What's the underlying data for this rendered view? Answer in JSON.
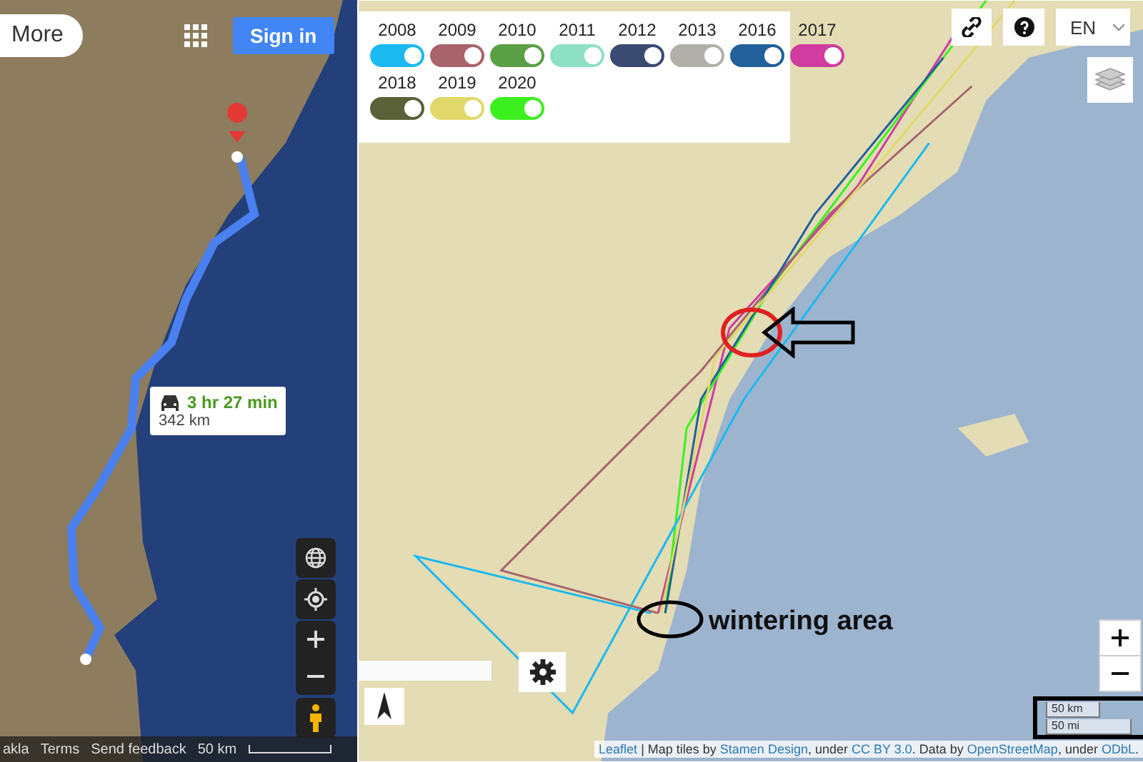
{
  "left_map": {
    "more_button": "More",
    "sign_in_button": "Sign in",
    "route_info": {
      "duration": "3 hr 27 min",
      "distance": "342 km"
    },
    "footer": {
      "attribution": "akla",
      "terms": "Terms",
      "feedback": "Send feedback",
      "scale": "50 km"
    }
  },
  "right_map": {
    "years": [
      {
        "label": "2008",
        "color": "#1ab9f0",
        "on": true
      },
      {
        "label": "2009",
        "color": "#a8636b",
        "on": true
      },
      {
        "label": "2010",
        "color": "#5a9e46",
        "on": true
      },
      {
        "label": "2011",
        "color": "#8ee0c4",
        "on": true
      },
      {
        "label": "2012",
        "color": "#3a4a70",
        "on": true
      },
      {
        "label": "2013",
        "color": "#b0b0a8",
        "on": true
      },
      {
        "label": "2016",
        "color": "#22609a",
        "on": true
      },
      {
        "label": "2017",
        "color": "#d03ca0",
        "on": true
      },
      {
        "label": "2018",
        "color": "#5a6038",
        "on": true
      },
      {
        "label": "2019",
        "color": "#e0d86a",
        "on": true
      },
      {
        "label": "2020",
        "color": "#3cf020",
        "on": true
      }
    ],
    "language": "EN",
    "annotation": "wintering area",
    "scale": [
      "50 km",
      "50 mi"
    ],
    "attribution": [
      {
        "kind": "link",
        "text": "Leaflet"
      },
      {
        "kind": "text",
        "text": " | Map tiles by "
      },
      {
        "kind": "link",
        "text": "Stamen Design"
      },
      {
        "kind": "text",
        "text": ", under "
      },
      {
        "kind": "link",
        "text": "CC BY 3.0"
      },
      {
        "kind": "text",
        "text": ". Data by "
      },
      {
        "kind": "link",
        "text": "OpenStreetMap"
      },
      {
        "kind": "text",
        "text": ", under "
      },
      {
        "kind": "link",
        "text": "ODbL"
      },
      {
        "kind": "text",
        "text": "."
      }
    ]
  }
}
